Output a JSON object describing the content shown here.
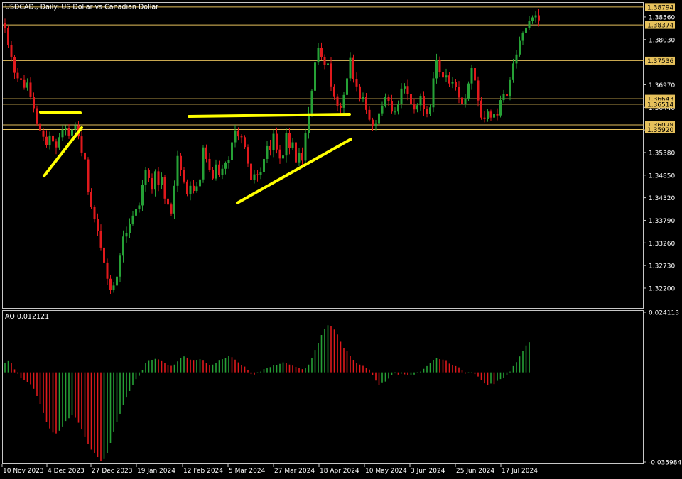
{
  "chart_title": "USDCAD., Daily:  US Dollar vs Canadian Dollar",
  "colors": {
    "background": "#000000",
    "bull": "#26a136",
    "bear": "#e0191c",
    "trendline": "#ffff00",
    "level": "#e6c15c",
    "frame": "#c8c8c8"
  },
  "chart_data": [
    {
      "type": "candlestick",
      "ylim": [
        1.3175,
        1.38875
      ],
      "price_ticks": [
        "1.38560",
        "1.38030",
        "1.37500",
        "1.36970",
        "1.36440",
        "1.35910",
        "1.35380",
        "1.34850",
        "1.34320",
        "1.33790",
        "1.33260",
        "1.32730",
        "1.32200"
      ],
      "horizontal_levels": [
        "1.38794",
        "1.38374",
        "1.37536",
        "1.36643",
        "1.36514",
        "1.36028",
        "1.35920"
      ],
      "date_ticks": [
        "10 Nov 2023",
        "4 Dec 2023",
        "27 Dec 2023",
        "19 Jan 2024",
        "12 Feb 2024",
        "5 Mar 2024",
        "27 Mar 2024",
        "18 Apr 2024",
        "10 May 2024",
        "3 Jun 2024",
        "25 Jun 2024",
        "17 Jul 2024"
      ],
      "closes": [
        1.383,
        1.379,
        1.3762,
        1.3725,
        1.3712,
        1.3708,
        1.369,
        1.3702,
        1.3668,
        1.3642,
        1.3605,
        1.359,
        1.3575,
        1.3556,
        1.3578,
        1.3564,
        1.355,
        1.3574,
        1.3592,
        1.3596,
        1.3578,
        1.3592,
        1.3602,
        1.3576,
        1.3538,
        1.3522,
        1.3445,
        1.341,
        1.3383,
        1.3354,
        1.3315,
        1.328,
        1.3242,
        1.3216,
        1.3226,
        1.3247,
        1.3296,
        1.3341,
        1.3349,
        1.3371,
        1.339,
        1.3406,
        1.3414,
        1.3462,
        1.3497,
        1.3478,
        1.3451,
        1.3494,
        1.3462,
        1.348,
        1.343,
        1.3416,
        1.3395,
        1.346,
        1.353,
        1.3497,
        1.347,
        1.344,
        1.346,
        1.3448,
        1.3459,
        1.3475,
        1.355,
        1.3523,
        1.3498,
        1.3477,
        1.351,
        1.3485,
        1.35,
        1.3513,
        1.352,
        1.3562,
        1.359,
        1.3576,
        1.3574,
        1.3551,
        1.3512,
        1.3474,
        1.3487,
        1.3485,
        1.3492,
        1.3523,
        1.3553,
        1.3543,
        1.3582,
        1.3545,
        1.3524,
        1.3531,
        1.3584,
        1.3548,
        1.3562,
        1.3515,
        1.3537,
        1.3519,
        1.3583,
        1.363,
        1.3683,
        1.3749,
        1.3784,
        1.3762,
        1.3744,
        1.3747,
        1.3693,
        1.367,
        1.3648,
        1.3643,
        1.3673,
        1.3712,
        1.376,
        1.3711,
        1.3693,
        1.3663,
        1.3669,
        1.3638,
        1.3615,
        1.3601,
        1.3605,
        1.363,
        1.3648,
        1.3668,
        1.3659,
        1.3634,
        1.3634,
        1.3652,
        1.3688,
        1.3694,
        1.3676,
        1.3651,
        1.3639,
        1.3649,
        1.3671,
        1.364,
        1.3629,
        1.3644,
        1.3712,
        1.3756,
        1.3726,
        1.3714,
        1.3719,
        1.37,
        1.3704,
        1.3692,
        1.3667,
        1.3652,
        1.3664,
        1.37,
        1.3736,
        1.3707,
        1.366,
        1.362,
        1.3617,
        1.3634,
        1.362,
        1.3628,
        1.3625,
        1.3661,
        1.3675,
        1.3671,
        1.3708,
        1.3747,
        1.3768,
        1.38,
        1.3818,
        1.3831,
        1.3847,
        1.3855,
        1.386,
        1.3848
      ]
    },
    {
      "type": "bar",
      "indicator_label": "AO 0.012121",
      "ylim": [
        -0.035984,
        0.024113
      ],
      "ticks": [
        "0.024113",
        "-0.035984"
      ],
      "values": [
        0.0039,
        0.0045,
        0.0037,
        0.0012,
        -0.0005,
        -0.0022,
        -0.0032,
        -0.004,
        -0.0048,
        -0.0066,
        -0.0095,
        -0.0129,
        -0.0163,
        -0.0198,
        -0.0225,
        -0.0241,
        -0.0245,
        -0.0234,
        -0.022,
        -0.0195,
        -0.0184,
        -0.0172,
        -0.0182,
        -0.0202,
        -0.0229,
        -0.026,
        -0.0286,
        -0.031,
        -0.0325,
        -0.034,
        -0.0355,
        -0.0348,
        -0.0324,
        -0.0283,
        -0.024,
        -0.02,
        -0.0166,
        -0.0132,
        -0.0101,
        -0.0075,
        -0.005,
        -0.0027,
        -0.0014,
        0.001,
        0.0038,
        0.0046,
        0.005,
        0.0054,
        0.0052,
        0.0045,
        0.0038,
        0.0028,
        0.0026,
        0.0031,
        0.0044,
        0.0058,
        0.0064,
        0.0059,
        0.0051,
        0.0047,
        0.0048,
        0.0053,
        0.0047,
        0.0036,
        0.003,
        0.0031,
        0.0038,
        0.0047,
        0.0053,
        0.0056,
        0.0065,
        0.0061,
        0.0051,
        0.004,
        0.0029,
        0.0023,
        0.0009,
        -0.0007,
        -0.0009,
        -0.0003,
        0.0003,
        0.0013,
        0.0016,
        0.0021,
        0.0028,
        0.0028,
        0.0034,
        0.004,
        0.0036,
        0.0031,
        0.0027,
        0.0022,
        0.0017,
        0.0013,
        0.0016,
        0.0031,
        0.0056,
        0.009,
        0.0118,
        0.015,
        0.0173,
        0.0189,
        0.0187,
        0.0172,
        0.0152,
        0.0123,
        0.0098,
        0.0085,
        0.0066,
        0.005,
        0.0039,
        0.0031,
        0.0026,
        0.0019,
        0.0011,
        -0.0011,
        -0.0033,
        -0.0051,
        -0.0043,
        -0.0037,
        -0.0025,
        -0.0012,
        -0.0004,
        -0.0009,
        -0.0005,
        -0.0008,
        -0.0012,
        -0.0012,
        -0.0009,
        -0.0003,
        0.0003,
        0.0014,
        0.0025,
        0.0036,
        0.0049,
        0.0058,
        0.0053,
        0.0051,
        0.0046,
        0.0035,
        0.0028,
        0.0025,
        0.002,
        0.001,
        -0.0005,
        -0.0003,
        -0.0002,
        -0.0007,
        -0.0017,
        -0.0031,
        -0.0044,
        -0.0052,
        -0.0045,
        -0.0047,
        -0.0034,
        -0.0027,
        -0.0021,
        -0.001,
        0.0003,
        0.0025,
        0.0041,
        0.0064,
        0.0086,
        0.0108,
        0.0121
      ]
    }
  ]
}
